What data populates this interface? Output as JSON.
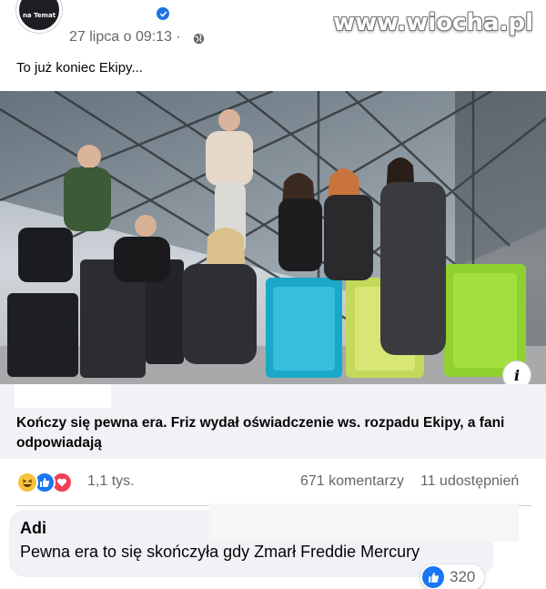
{
  "post": {
    "avatar_text": "na Temat",
    "timestamp": "27 lipca o 09:13 ·",
    "text": "To już koniec Ekipy..."
  },
  "watermark": "www.wiocha.pl",
  "link_preview": {
    "title": "Kończy się pewna era. Friz wydał oświadczenie ws. rozpadu Ekipy, a fani odpowiadają"
  },
  "reactions": {
    "icons": [
      "haha-icon",
      "like-icon",
      "love-icon"
    ],
    "count": "1,1 tys.",
    "comments": "671 komentarzy",
    "shares": "11 udostępnień"
  },
  "comment": {
    "author": "Adi",
    "text": "Pewna era to się skończyła gdy Zmarł Freddie Mercury",
    "likes": "320"
  },
  "colors": {
    "accent": "#1877f2",
    "secondary_text": "#65676b",
    "bubble": "#f0f2f5",
    "love": "#f33e58",
    "haha": "#f7c33b"
  }
}
